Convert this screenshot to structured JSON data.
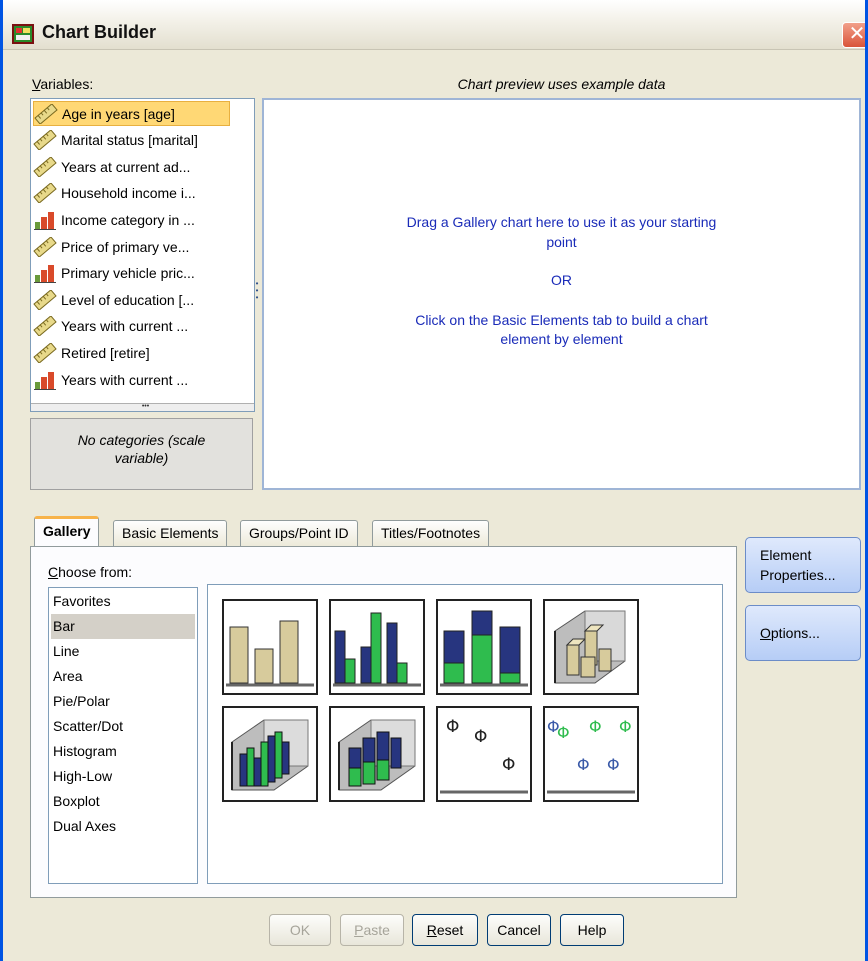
{
  "window": {
    "title": "Chart Builder",
    "close_label": "✕"
  },
  "variables": {
    "label_prefix": "V",
    "label_rest": "ariables:",
    "items": [
      {
        "label": "Age in years [age]",
        "type": "scale",
        "selected": true
      },
      {
        "label": "Marital status [marital]",
        "type": "scale"
      },
      {
        "label": "Years at current ad...",
        "type": "scale"
      },
      {
        "label": "Household income i...",
        "type": "scale"
      },
      {
        "label": "Income category in ...",
        "type": "ordinal"
      },
      {
        "label": "Price of primary ve...",
        "type": "scale"
      },
      {
        "label": "Primary vehicle pric...",
        "type": "ordinal"
      },
      {
        "label": "Level of education [...",
        "type": "scale"
      },
      {
        "label": "Years with current ...",
        "type": "scale"
      },
      {
        "label": "Retired [retire]",
        "type": "scale"
      },
      {
        "label": "Years with current ...",
        "type": "ordinal"
      }
    ]
  },
  "categories_box": {
    "line1": "No categories (scale",
    "line2": "variable)"
  },
  "preview": {
    "heading": "Chart preview uses example data",
    "line1": "Drag a Gallery chart here to use it as your starting",
    "line2": "point",
    "line3": "OR",
    "line4": "Click on the Basic Elements tab to build a chart",
    "line5": "element by element"
  },
  "tabs": [
    {
      "label": "Gallery",
      "active": true
    },
    {
      "label": "Basic Elements"
    },
    {
      "label": "Groups/Point ID"
    },
    {
      "label": "Titles/Footnotes"
    }
  ],
  "choose_from": {
    "label_prefix": "C",
    "label_rest": "hoose from:",
    "items": [
      "Favorites",
      "Bar",
      "Line",
      "Area",
      "Pie/Polar",
      "Scatter/Dot",
      "Histogram",
      "High-Low",
      "Boxplot",
      "Dual Axes"
    ],
    "selected": "Bar"
  },
  "gallery_thumbnails": [
    {
      "name": "simple-bar"
    },
    {
      "name": "clustered-bar"
    },
    {
      "name": "stacked-bar"
    },
    {
      "name": "simple-3d-bar"
    },
    {
      "name": "clustered-3d-bar"
    },
    {
      "name": "stacked-3d-bar"
    },
    {
      "name": "simple-error-bar"
    },
    {
      "name": "clustered-error-bar"
    }
  ],
  "side_buttons": {
    "element_properties_line1_pre": "Element",
    "element_properties_line2": "Properties...",
    "options_pre": "O",
    "options_rest": "ptions..."
  },
  "buttons": {
    "ok": "OK",
    "paste_pre": "P",
    "paste_rest": "aste",
    "reset_pre": "R",
    "reset_rest": "eset",
    "cancel": "Cancel",
    "help": "Help"
  },
  "colors": {
    "bar_tan": "#d7cb9c",
    "bar_navy": "#27357f",
    "bar_green": "#2fbc4e",
    "preview_text": "#1a2bb8",
    "selection": "#ffd875"
  }
}
